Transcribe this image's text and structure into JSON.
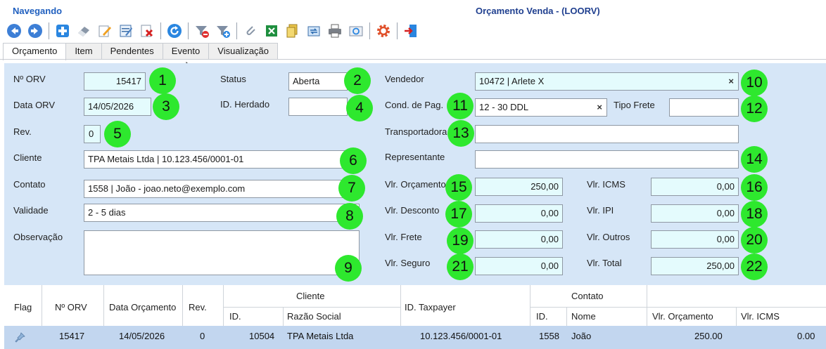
{
  "header": {
    "mode": "Navegando",
    "title": "Orçamento Venda - (LOORV)"
  },
  "toolbar": {
    "buttons": [
      "back-icon",
      "forward-icon",
      "add-icon",
      "eraser-icon",
      "edit-icon",
      "edit-form-icon",
      "delete-icon",
      "refresh-icon",
      "filter-clear-icon",
      "filter-add-icon",
      "attach-icon",
      "excel-icon",
      "copy-icon",
      "transfer-icon",
      "print-icon",
      "email-icon",
      "settings-icon",
      "exit-icon"
    ]
  },
  "tabs": [
    "Orçamento",
    "Item",
    "Pendentes",
    "Evento",
    "Visualização"
  ],
  "form": {
    "num_orv_label": "Nº ORV",
    "num_orv": "15417",
    "status_label": "Status",
    "status": "Aberta",
    "vendedor_label": "Vendedor",
    "vendedor": "10472 | Arlete X",
    "data_orv_label": "Data ORV",
    "data_orv": "14/05/2026",
    "id_herdado_label": "ID. Herdado",
    "id_herdado": "",
    "cond_pag_label": "Cond. de Pag.",
    "cond_pag": "12 - 30 DDL",
    "tipo_frete_label": "Tipo Frete",
    "tipo_frete": "",
    "rev_label": "Rev.",
    "rev": "0",
    "transportadora_label": "Transportadora",
    "transportadora": "",
    "cliente_label": "Cliente",
    "cliente": "TPA Metais Ltda | 10.123.456/0001-01",
    "representante_label": "Representante",
    "representante": "",
    "contato_label": "Contato",
    "contato": "1558 | João - joao.neto@exemplo.com",
    "vlr_orcamento_label": "Vlr. Orçamento",
    "vlr_orcamento": "250,00",
    "vlr_icms_label": "Vlr. ICMS",
    "vlr_icms": "0,00",
    "validade_label": "Validade",
    "validade": "2 - 5 dias",
    "vlr_desconto_label": "Vlr. Desconto",
    "vlr_desconto": "0,00",
    "vlr_ipi_label": "Vlr. IPI",
    "vlr_ipi": "0,00",
    "observacao_label": "Observação",
    "observacao": "",
    "vlr_frete_label": "Vlr. Frete",
    "vlr_frete": "0,00",
    "vlr_outros_label": "Vlr. Outros",
    "vlr_outros": "0,00",
    "vlr_seguro_label": "Vlr. Seguro",
    "vlr_seguro": "0,00",
    "vlr_total_label": "Vlr. Total",
    "vlr_total": "250,00",
    "clear_symbol": "×"
  },
  "badges": [
    "1",
    "2",
    "3",
    "4",
    "5",
    "6",
    "7",
    "8",
    "9",
    "10",
    "11",
    "12",
    "13",
    "14",
    "15",
    "16",
    "17",
    "18",
    "19",
    "20",
    "21",
    "22"
  ],
  "grid": {
    "headers": {
      "flag": "Flag",
      "num_orv": "Nº ORV",
      "data_orcamento": "Data Orçamento",
      "rev": "Rev.",
      "cliente_group": "Cliente",
      "cliente_id": "ID.",
      "razao_social": "Razão Social",
      "id_taxpayer": "ID. Taxpayer",
      "contato_group": "Contato",
      "contato_id": "ID.",
      "nome": "Nome",
      "vlr_orcamento": "Vlr. Orçamento",
      "vlr_icms": "Vlr. ICMS"
    },
    "rows": [
      {
        "flag_icon": "pin-icon",
        "num_orv": "15417",
        "data_orcamento": "14/05/2026",
        "rev": "0",
        "cliente_id": "10504",
        "razao_social": "TPA Metais Ltda",
        "id_taxpayer": "10.123.456/0001-01",
        "contato_id": "1558",
        "nome": "João",
        "vlr_orcamento": "250.00",
        "vlr_icms": "0.00"
      }
    ]
  },
  "colors": {
    "panel": "#d6e6f7",
    "field_cyan": "#e4fbfd",
    "badge": "#2ee82e",
    "row_selected": "#c2d6ef",
    "title_blue": "#1f5fbf"
  }
}
